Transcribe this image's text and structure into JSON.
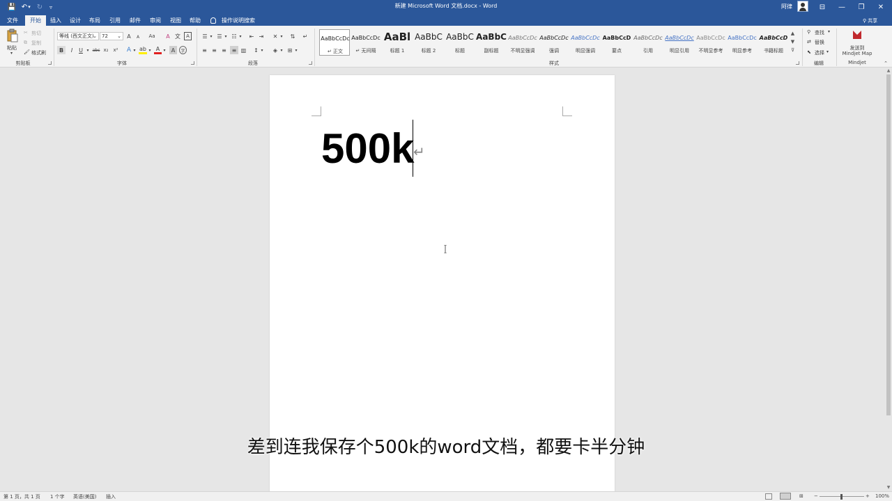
{
  "window": {
    "title": "新建 Microsoft Word 文档.docx  -  Word",
    "user": "阿律",
    "controls": {
      "ribbon_options": "⊟",
      "minimize": "—",
      "restore": "❐",
      "close": "✕"
    }
  },
  "quick_access": {
    "save_icon": "💾",
    "undo_icon": "↶",
    "undo_arrow": "▾",
    "redo_icon": "↻",
    "customize_icon": "▿"
  },
  "tabs": [
    {
      "label": "文件"
    },
    {
      "label": "开始",
      "active": true
    },
    {
      "label": "插入"
    },
    {
      "label": "设计"
    },
    {
      "label": "布局"
    },
    {
      "label": "引用"
    },
    {
      "label": "邮件"
    },
    {
      "label": "审阅"
    },
    {
      "label": "视图"
    },
    {
      "label": "帮助"
    }
  ],
  "tell_me": "操作说明搜索",
  "share": "共享",
  "clipboard": {
    "group": "剪贴板",
    "paste": "粘贴",
    "cut": "剪切",
    "copy": "复制",
    "format_painter": "格式刷"
  },
  "font": {
    "group": "字体",
    "font_name": "等线 (西文正文)",
    "font_size": "72",
    "grow": "A",
    "shrink": "A",
    "case": "Aa",
    "bold": "B",
    "italic": "I",
    "underline": "U",
    "strike": "abc",
    "subscript": "x₂",
    "superscript": "x²",
    "font_color": "A",
    "char_shade": "A"
  },
  "paragraph": {
    "group": "段落"
  },
  "styles": {
    "group": "样式",
    "items": [
      {
        "preview": "AaBbCcDc",
        "name": "↵ 正文",
        "selected": true
      },
      {
        "preview": "AaBbCcDc",
        "name": "↵ 无间隔"
      },
      {
        "preview": "AaBl",
        "name": "标题 1"
      },
      {
        "preview": "AaBbC",
        "name": "标题 2"
      },
      {
        "preview": "AaBbC",
        "name": "标题"
      },
      {
        "preview": "AaBbC",
        "name": "副标题"
      },
      {
        "preview": "AaBbCcDc",
        "name": "不明显强调"
      },
      {
        "preview": "AaBbCcDc",
        "name": "强调"
      },
      {
        "preview": "AaBbCcDc",
        "name": "明显强调"
      },
      {
        "preview": "AaBbCcD",
        "name": "要点"
      },
      {
        "preview": "AaBbCcDc",
        "name": "引用"
      },
      {
        "preview": "AaBbCcDc",
        "name": "明显引用"
      },
      {
        "preview": "AaBbCcDc",
        "name": "不明显参考"
      },
      {
        "preview": "AaBbCcDc",
        "name": "明显参考"
      },
      {
        "preview": "AaBbCcD",
        "name": "书籍标题"
      }
    ]
  },
  "editing": {
    "group": "编辑",
    "find": "查找",
    "replace": "替换",
    "select": "选择"
  },
  "mindjet": {
    "group": "Mindjet",
    "send_line1": "发送到",
    "send_line2": "Mindjet Map"
  },
  "document": {
    "text": "500k",
    "paragraph_mark": "↵"
  },
  "subtitle": "差到连我保存个500k的word文档，都要卡半分钟",
  "status": {
    "page": "第 1 页，共 1 页",
    "words": "1 个字",
    "language": "英语(美国)",
    "mode": "插入",
    "zoom_minus": "−",
    "zoom_plus": "+",
    "zoom": "100%"
  },
  "colors": {
    "brand": "#2b579a",
    "ribbon_bg": "#f3f3f3",
    "workspace_bg": "#e6e6e6",
    "font_color_bar": "#e02020",
    "highlight_bar": "#ffee00",
    "mindjet_red": "#c0282d"
  }
}
